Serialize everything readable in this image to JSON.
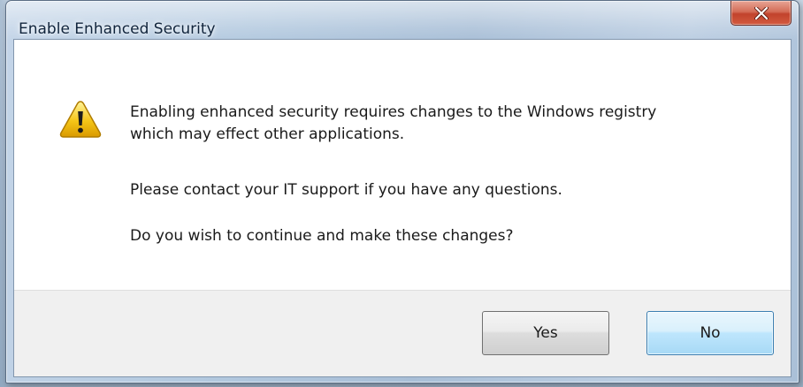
{
  "window": {
    "title": "Enable Enhanced Security"
  },
  "dialog": {
    "icon": "warning-icon",
    "message_lines": [
      "Enabling enhanced security requires changes to the Windows registry",
      "which may effect other applications.",
      "Please contact your IT support if you have any questions.",
      "Do you wish to continue and make these changes?"
    ]
  },
  "buttons": {
    "yes_label": "Yes",
    "no_label": "No"
  },
  "colors": {
    "close_button": "#c2432c",
    "warning_yellow": "#f5c517",
    "default_button_border": "#3c7fb1"
  }
}
